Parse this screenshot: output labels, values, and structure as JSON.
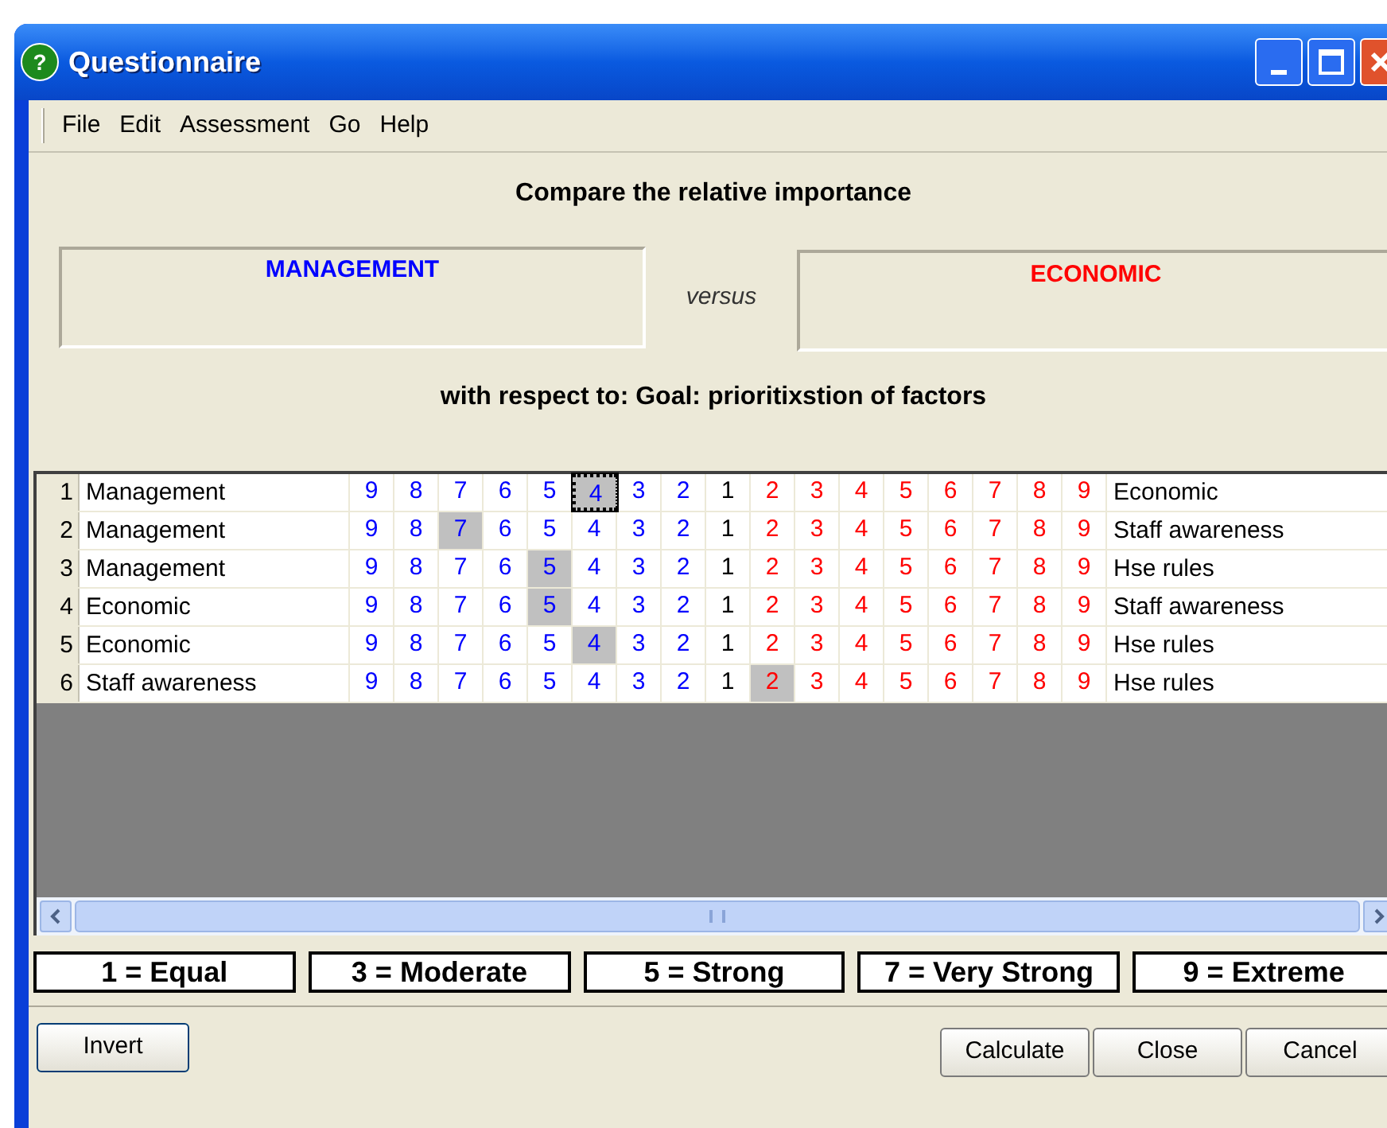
{
  "window": {
    "title": "Questionnaire",
    "icon": "?"
  },
  "menu": [
    "File",
    "Edit",
    "Assessment",
    "Go",
    "Help"
  ],
  "heading": "Compare the relative importance",
  "left_box": "MANAGEMENT",
  "versus": "versus",
  "right_box": "ECONOMIC",
  "respect": "with respect to: Goal: prioritixstion of factors",
  "rows": [
    {
      "number": "1",
      "left": "Management",
      "right": "Economic",
      "focused": true,
      "cells": [
        {
          "label": "9",
          "kind": "left",
          "selected": false
        },
        {
          "label": "8",
          "kind": "left",
          "selected": false
        },
        {
          "label": "7",
          "kind": "left",
          "selected": false
        },
        {
          "label": "6",
          "kind": "left",
          "selected": false
        },
        {
          "label": "5",
          "kind": "left",
          "selected": false
        },
        {
          "label": "4",
          "kind": "left",
          "selected": true
        },
        {
          "label": "3",
          "kind": "left",
          "selected": false
        },
        {
          "label": "2",
          "kind": "left",
          "selected": false
        },
        {
          "label": "1",
          "kind": "equal",
          "selected": false
        },
        {
          "label": "2",
          "kind": "right",
          "selected": false
        },
        {
          "label": "3",
          "kind": "right",
          "selected": false
        },
        {
          "label": "4",
          "kind": "right",
          "selected": false
        },
        {
          "label": "5",
          "kind": "right",
          "selected": false
        },
        {
          "label": "6",
          "kind": "right",
          "selected": false
        },
        {
          "label": "7",
          "kind": "right",
          "selected": false
        },
        {
          "label": "8",
          "kind": "right",
          "selected": false
        },
        {
          "label": "9",
          "kind": "right",
          "selected": false
        }
      ]
    },
    {
      "number": "2",
      "left": "Management",
      "right": "Staff awareness",
      "focused": false,
      "cells": [
        {
          "label": "9",
          "kind": "left",
          "selected": false
        },
        {
          "label": "8",
          "kind": "left",
          "selected": false
        },
        {
          "label": "7",
          "kind": "left",
          "selected": true
        },
        {
          "label": "6",
          "kind": "left",
          "selected": false
        },
        {
          "label": "5",
          "kind": "left",
          "selected": false
        },
        {
          "label": "4",
          "kind": "left",
          "selected": false
        },
        {
          "label": "3",
          "kind": "left",
          "selected": false
        },
        {
          "label": "2",
          "kind": "left",
          "selected": false
        },
        {
          "label": "1",
          "kind": "equal",
          "selected": false
        },
        {
          "label": "2",
          "kind": "right",
          "selected": false
        },
        {
          "label": "3",
          "kind": "right",
          "selected": false
        },
        {
          "label": "4",
          "kind": "right",
          "selected": false
        },
        {
          "label": "5",
          "kind": "right",
          "selected": false
        },
        {
          "label": "6",
          "kind": "right",
          "selected": false
        },
        {
          "label": "7",
          "kind": "right",
          "selected": false
        },
        {
          "label": "8",
          "kind": "right",
          "selected": false
        },
        {
          "label": "9",
          "kind": "right",
          "selected": false
        }
      ]
    },
    {
      "number": "3",
      "left": "Management",
      "right": "Hse rules",
      "focused": false,
      "cells": [
        {
          "label": "9",
          "kind": "left",
          "selected": false
        },
        {
          "label": "8",
          "kind": "left",
          "selected": false
        },
        {
          "label": "7",
          "kind": "left",
          "selected": false
        },
        {
          "label": "6",
          "kind": "left",
          "selected": false
        },
        {
          "label": "5",
          "kind": "left",
          "selected": true
        },
        {
          "label": "4",
          "kind": "left",
          "selected": false
        },
        {
          "label": "3",
          "kind": "left",
          "selected": false
        },
        {
          "label": "2",
          "kind": "left",
          "selected": false
        },
        {
          "label": "1",
          "kind": "equal",
          "selected": false
        },
        {
          "label": "2",
          "kind": "right",
          "selected": false
        },
        {
          "label": "3",
          "kind": "right",
          "selected": false
        },
        {
          "label": "4",
          "kind": "right",
          "selected": false
        },
        {
          "label": "5",
          "kind": "right",
          "selected": false
        },
        {
          "label": "6",
          "kind": "right",
          "selected": false
        },
        {
          "label": "7",
          "kind": "right",
          "selected": false
        },
        {
          "label": "8",
          "kind": "right",
          "selected": false
        },
        {
          "label": "9",
          "kind": "right",
          "selected": false
        }
      ]
    },
    {
      "number": "4",
      "left": "Economic",
      "right": "Staff awareness",
      "focused": false,
      "cells": [
        {
          "label": "9",
          "kind": "left",
          "selected": false
        },
        {
          "label": "8",
          "kind": "left",
          "selected": false
        },
        {
          "label": "7",
          "kind": "left",
          "selected": false
        },
        {
          "label": "6",
          "kind": "left",
          "selected": false
        },
        {
          "label": "5",
          "kind": "left",
          "selected": true
        },
        {
          "label": "4",
          "kind": "left",
          "selected": false
        },
        {
          "label": "3",
          "kind": "left",
          "selected": false
        },
        {
          "label": "2",
          "kind": "left",
          "selected": false
        },
        {
          "label": "1",
          "kind": "equal",
          "selected": false
        },
        {
          "label": "2",
          "kind": "right",
          "selected": false
        },
        {
          "label": "3",
          "kind": "right",
          "selected": false
        },
        {
          "label": "4",
          "kind": "right",
          "selected": false
        },
        {
          "label": "5",
          "kind": "right",
          "selected": false
        },
        {
          "label": "6",
          "kind": "right",
          "selected": false
        },
        {
          "label": "7",
          "kind": "right",
          "selected": false
        },
        {
          "label": "8",
          "kind": "right",
          "selected": false
        },
        {
          "label": "9",
          "kind": "right",
          "selected": false
        }
      ]
    },
    {
      "number": "5",
      "left": "Economic",
      "right": "Hse rules",
      "focused": false,
      "cells": [
        {
          "label": "9",
          "kind": "left",
          "selected": false
        },
        {
          "label": "8",
          "kind": "left",
          "selected": false
        },
        {
          "label": "7",
          "kind": "left",
          "selected": false
        },
        {
          "label": "6",
          "kind": "left",
          "selected": false
        },
        {
          "label": "5",
          "kind": "left",
          "selected": false
        },
        {
          "label": "4",
          "kind": "left",
          "selected": true
        },
        {
          "label": "3",
          "kind": "left",
          "selected": false
        },
        {
          "label": "2",
          "kind": "left",
          "selected": false
        },
        {
          "label": "1",
          "kind": "equal",
          "selected": false
        },
        {
          "label": "2",
          "kind": "right",
          "selected": false
        },
        {
          "label": "3",
          "kind": "right",
          "selected": false
        },
        {
          "label": "4",
          "kind": "right",
          "selected": false
        },
        {
          "label": "5",
          "kind": "right",
          "selected": false
        },
        {
          "label": "6",
          "kind": "right",
          "selected": false
        },
        {
          "label": "7",
          "kind": "right",
          "selected": false
        },
        {
          "label": "8",
          "kind": "right",
          "selected": false
        },
        {
          "label": "9",
          "kind": "right",
          "selected": false
        }
      ]
    },
    {
      "number": "6",
      "left": "Staff awareness",
      "right": "Hse rules",
      "focused": false,
      "cells": [
        {
          "label": "9",
          "kind": "left",
          "selected": false
        },
        {
          "label": "8",
          "kind": "left",
          "selected": false
        },
        {
          "label": "7",
          "kind": "left",
          "selected": false
        },
        {
          "label": "6",
          "kind": "left",
          "selected": false
        },
        {
          "label": "5",
          "kind": "left",
          "selected": false
        },
        {
          "label": "4",
          "kind": "left",
          "selected": false
        },
        {
          "label": "3",
          "kind": "left",
          "selected": false
        },
        {
          "label": "2",
          "kind": "left",
          "selected": false
        },
        {
          "label": "1",
          "kind": "equal",
          "selected": false
        },
        {
          "label": "2",
          "kind": "right",
          "selected": true
        },
        {
          "label": "3",
          "kind": "right",
          "selected": false
        },
        {
          "label": "4",
          "kind": "right",
          "selected": false
        },
        {
          "label": "5",
          "kind": "right",
          "selected": false
        },
        {
          "label": "6",
          "kind": "right",
          "selected": false
        },
        {
          "label": "7",
          "kind": "right",
          "selected": false
        },
        {
          "label": "8",
          "kind": "right",
          "selected": false
        },
        {
          "label": "9",
          "kind": "right",
          "selected": false
        }
      ]
    }
  ],
  "legend": [
    "1 = Equal",
    "3 = Moderate",
    "5 = Strong",
    "7 = Very Strong",
    "9 = Extreme"
  ],
  "buttons_left": [
    "Invert"
  ],
  "buttons_right": [
    "Calculate",
    "Close",
    "Cancel"
  ]
}
